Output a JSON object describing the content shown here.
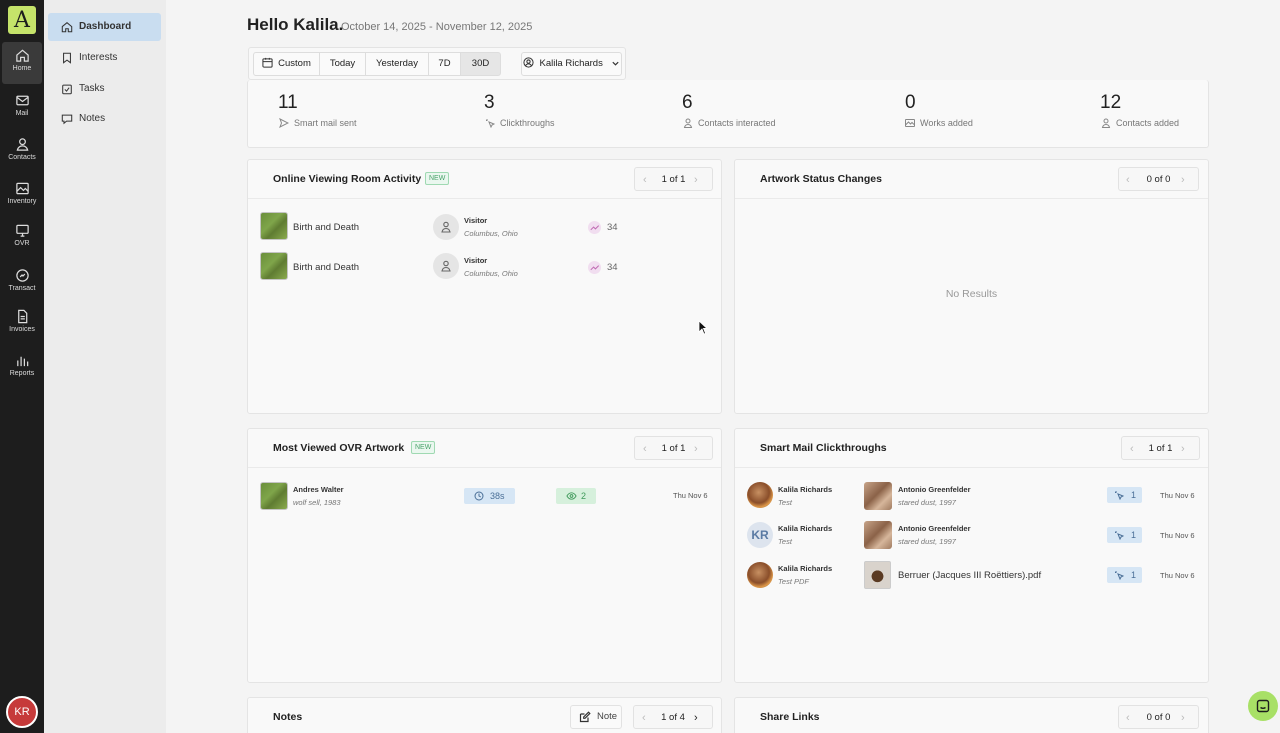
{
  "rail": {
    "logo": "A",
    "items": [
      {
        "label": "Home",
        "icon": "home-icon"
      },
      {
        "label": "Mail",
        "icon": "mail-icon"
      },
      {
        "label": "Contacts",
        "icon": "contacts-icon"
      },
      {
        "label": "Inventory",
        "icon": "inventory-icon"
      },
      {
        "label": "OVR",
        "icon": "ovr-icon"
      },
      {
        "label": "Transact",
        "icon": "transact-icon"
      },
      {
        "label": "Invoices",
        "icon": "invoices-icon"
      },
      {
        "label": "Reports",
        "icon": "reports-icon"
      }
    ],
    "avatar": "KR"
  },
  "submenu": {
    "items": [
      {
        "label": "Dashboard",
        "icon": "home-icon"
      },
      {
        "label": "Interests",
        "icon": "bookmark-icon"
      },
      {
        "label": "Tasks",
        "icon": "tasks-icon"
      },
      {
        "label": "Notes",
        "icon": "note-icon"
      }
    ]
  },
  "header": {
    "greeting": "Hello Kalila.",
    "date_range": "October 14, 2025 - November 12, 2025"
  },
  "filters": {
    "custom": "Custom",
    "today": "Today",
    "yesterday": "Yesterday",
    "d7": "7D",
    "d30": "30D",
    "selected": "30D",
    "user": "Kalila Richards"
  },
  "stats": [
    {
      "value": "11",
      "label": "Smart mail sent",
      "icon": "send-icon"
    },
    {
      "value": "3",
      "label": "Clickthroughs",
      "icon": "click-icon"
    },
    {
      "value": "6",
      "label": "Contacts interacted",
      "icon": "person-icon"
    },
    {
      "value": "0",
      "label": "Works added",
      "icon": "image-icon"
    },
    {
      "value": "12",
      "label": "Contacts added",
      "icon": "person-icon"
    }
  ],
  "ovr_activity": {
    "title": "Online Viewing Room Activity",
    "badge": "NEW",
    "pager": "1 of 1",
    "rows": [
      {
        "artwork": "Birth and Death",
        "visitor": "Visitor",
        "location": "Columbus, Ohio",
        "count": "34"
      },
      {
        "artwork": "Birth and Death",
        "visitor": "Visitor",
        "location": "Columbus, Ohio",
        "count": "34"
      }
    ]
  },
  "artwork_status": {
    "title": "Artwork Status Changes",
    "pager": "0 of 0",
    "empty": "No Results"
  },
  "most_viewed": {
    "title": "Most Viewed OVR Artwork",
    "badge": "NEW",
    "pager": "1 of 1",
    "rows": [
      {
        "artist": "Andres Walter",
        "work": "wolf sell, 1983",
        "time": "38s",
        "views": "2",
        "date": "Thu Nov 6"
      }
    ]
  },
  "clickthroughs": {
    "title": "Smart Mail Clickthroughs",
    "pager": "1 of 1",
    "rows": [
      {
        "sender": "Kalila Richards",
        "subject": "Test",
        "item_title": "Antonio Greenfelder",
        "item_sub": "stared dust, 1997",
        "count": "1",
        "date": "Thu Nov 6",
        "avatar": "photo"
      },
      {
        "sender": "Kalila Richards",
        "subject": "Test",
        "item_title": "Antonio Greenfelder",
        "item_sub": "stared dust, 1997",
        "count": "1",
        "date": "Thu Nov 6",
        "avatar": "KR"
      },
      {
        "sender": "Kalila Richards",
        "subject": "Test PDF",
        "item_title": "Berruer (Jacques III Roëttiers).pdf",
        "item_sub": "",
        "count": "1",
        "date": "Thu Nov 6",
        "avatar": "photo"
      }
    ]
  },
  "notes": {
    "title": "Notes",
    "note_button": "Note",
    "pager": "1 of 4"
  },
  "share_links": {
    "title": "Share Links",
    "pager": "0 of 0"
  }
}
